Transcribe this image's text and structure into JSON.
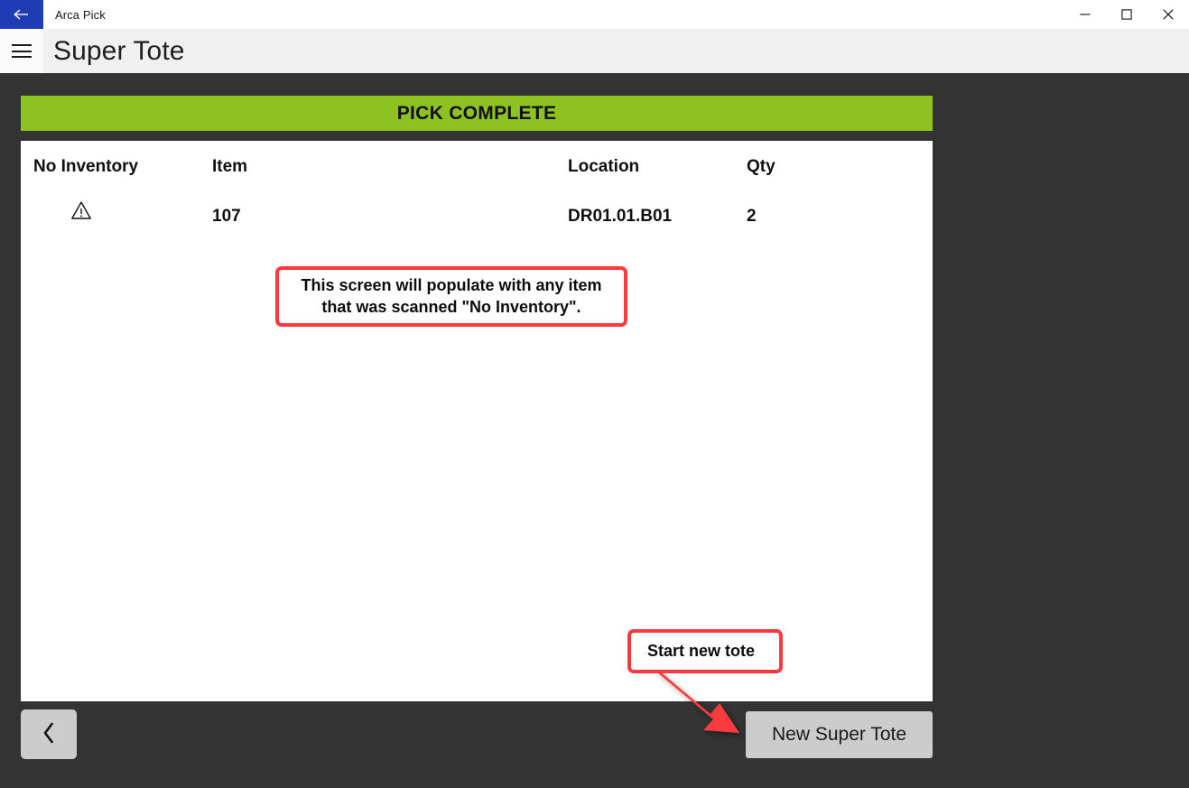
{
  "window": {
    "back_icon": "arrow-left-icon",
    "title": "Arca Pick",
    "controls": {
      "minimize": "minimize-icon",
      "maximize": "maximize-icon",
      "close": "close-icon"
    }
  },
  "header": {
    "menu_icon": "hamburger-menu-icon",
    "page_title": "Super Tote"
  },
  "banner": {
    "text": "PICK COMPLETE",
    "color": "#8dc220"
  },
  "table": {
    "columns": [
      "No Inventory",
      "Item",
      "Location",
      "Qty"
    ],
    "rows": [
      {
        "no_inventory_icon": "warning-triangle-icon",
        "item": "107",
        "location": "DR01.01.B01",
        "qty": "2"
      }
    ]
  },
  "footer": {
    "back_icon": "chevron-left-icon",
    "new_super_tote_label": "New Super Tote"
  },
  "annotations": {
    "color": "#fa3a3e",
    "note": "This screen will populate with any item that was scanned \"No Inventory\".",
    "tote": "Start new tote",
    "arrow_icon": "arrow-down-right-icon"
  }
}
